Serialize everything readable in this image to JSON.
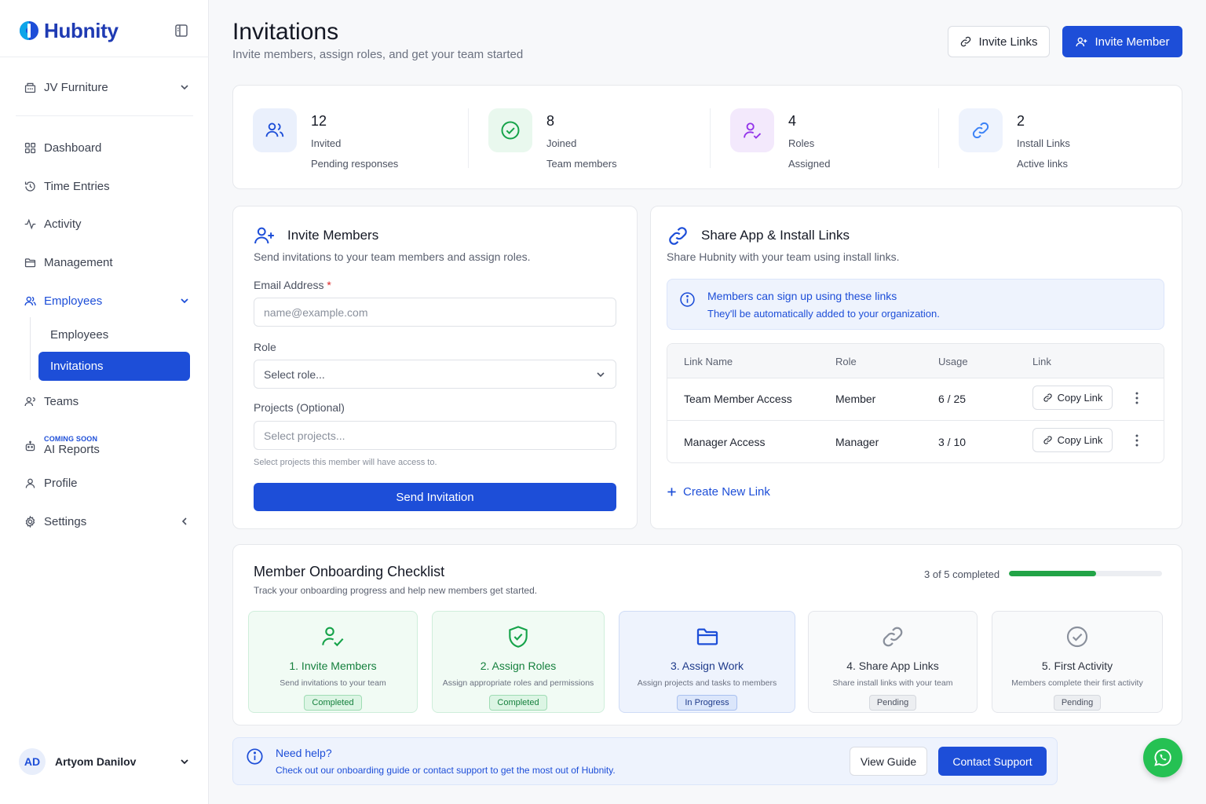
{
  "brand": {
    "name": "Hubnity"
  },
  "workspace": {
    "name": "JV Furniture"
  },
  "nav": {
    "dashboard": "Dashboard",
    "time_entries": "Time Entries",
    "activity": "Activity",
    "management": "Management",
    "employees": "Employees",
    "employees_sub": "Employees",
    "invitations": "Invitations",
    "teams": "Teams",
    "ai_reports_tag": "COMING SOON",
    "ai_reports": "AI Reports",
    "profile": "Profile",
    "settings": "Settings"
  },
  "user": {
    "initials": "AD",
    "name": "Artyom Danilov"
  },
  "header": {
    "title": "Invitations",
    "subtitle": "Invite members, assign roles, and get your team started",
    "invite_links_label": "Invite Links",
    "invite_member_label": "Invite Member"
  },
  "stats": [
    {
      "value": "12",
      "label": "Invited",
      "sub": "Pending responses"
    },
    {
      "value": "8",
      "label": "Joined",
      "sub": "Team members"
    },
    {
      "value": "4",
      "label": "Roles",
      "sub": "Assigned"
    },
    {
      "value": "2",
      "label": "Install Links",
      "sub": "Active links"
    }
  ],
  "invite_form": {
    "title": "Invite Members",
    "subtitle": "Send invitations to your team members and assign roles.",
    "email_label": "Email Address",
    "email_required": "*",
    "email_placeholder": "name@example.com",
    "role_label": "Role",
    "role_placeholder": "Select role...",
    "projects_label": "Projects (Optional)",
    "projects_placeholder": "Select projects...",
    "projects_helper": "Select projects this member will have access to.",
    "send_label": "Send Invitation"
  },
  "share": {
    "title": "Share App & Install Links",
    "subtitle": "Share Hubnity with your team using install links.",
    "info_title": "Members can sign up using these links",
    "info_text": "They'll be automatically added to your organization.",
    "columns": [
      "Link Name",
      "Role",
      "Usage",
      "Link"
    ],
    "rows": [
      {
        "name": "Team Member Access",
        "role": "Member",
        "usage": "6 / 25",
        "link_label": "Copy Link"
      },
      {
        "name": "Manager Access",
        "role": "Manager",
        "usage": "3 / 10",
        "link_label": "Copy Link"
      }
    ],
    "create_label": "Create New Link"
  },
  "checklist": {
    "title": "Member Onboarding Checklist",
    "subtitle": "Track your onboarding progress and help new members get started.",
    "progress_text": "3 of 5 completed",
    "progress_fraction": 0.57,
    "steps": [
      {
        "title": "1. Invite Members",
        "desc": "Send invitations to your team",
        "status": "Completed"
      },
      {
        "title": "2. Assign Roles",
        "desc": "Assign appropriate roles and permissions",
        "status": "Completed"
      },
      {
        "title": "3. Assign Work",
        "desc": "Assign projects and tasks to members",
        "status": "In Progress"
      },
      {
        "title": "4. Share App Links",
        "desc": "Share install links with your team",
        "status": "Pending"
      },
      {
        "title": "5. First Activity",
        "desc": "Members complete their first activity",
        "status": "Pending"
      }
    ]
  },
  "help": {
    "title": "Need help?",
    "text": "Check out our onboarding guide or contact support to get the most out of Hubnity.",
    "guide_label": "View Guide",
    "support_label": "Contact Support"
  },
  "colors": {
    "primary": "#1d4ed8",
    "success": "#22a447",
    "whatsapp": "#25c153"
  }
}
